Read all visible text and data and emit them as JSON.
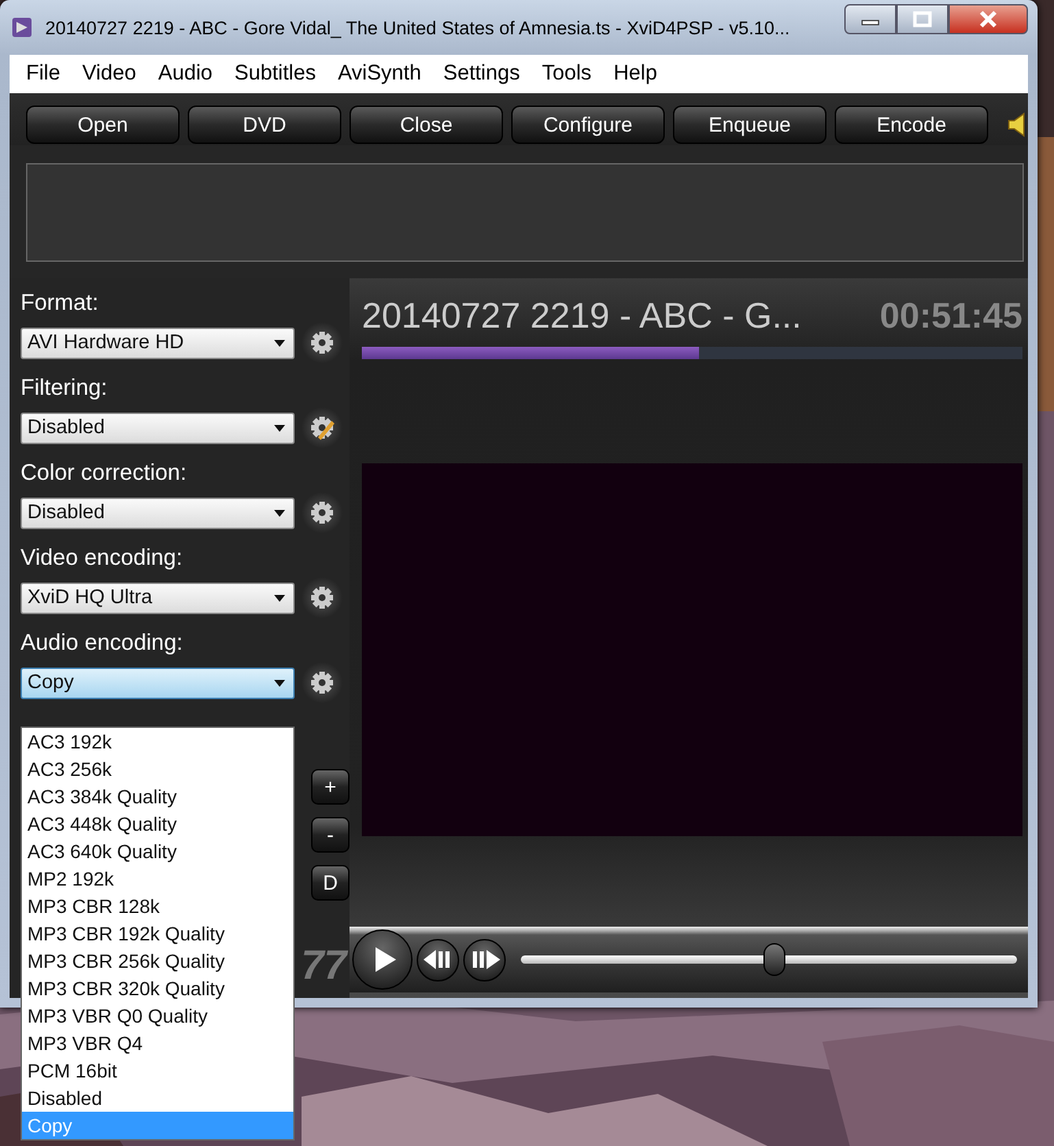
{
  "window": {
    "title": "20140727 2219 - ABC - Gore Vidal_ The United States of Amnesia.ts  - XviD4PSP - v5.10..."
  },
  "menu": [
    "File",
    "Video",
    "Audio",
    "Subtitles",
    "AviSynth",
    "Settings",
    "Tools",
    "Help"
  ],
  "toolbar": [
    "Open",
    "DVD",
    "Close",
    "Configure",
    "Enqueue",
    "Encode"
  ],
  "settings": [
    {
      "label": "Format:",
      "value": "AVI Hardware HD",
      "focused": false,
      "kind": "gear"
    },
    {
      "label": "Filtering:",
      "value": "Disabled",
      "focused": false,
      "kind": "edit"
    },
    {
      "label": "Color correction:",
      "value": "Disabled",
      "focused": false,
      "kind": "gear"
    },
    {
      "label": "Video encoding:",
      "value": "XviD HQ Ultra",
      "focused": false,
      "kind": "gear"
    },
    {
      "label": "Audio encoding:",
      "value": "Copy",
      "focused": true,
      "kind": "gear"
    }
  ],
  "side_buttons": [
    "+",
    "-",
    "D"
  ],
  "counter": "77",
  "player": {
    "file_title": "20140727 2219 - ABC - G...",
    "time": "00:51:45",
    "progress": {
      "level": 0.51
    },
    "seek": {
      "level": 0.51
    }
  },
  "dropdown": {
    "items": [
      {
        "label": "AC3 192k",
        "selected": false
      },
      {
        "label": "AC3 256k",
        "selected": false
      },
      {
        "label": "AC3 384k Quality",
        "selected": false
      },
      {
        "label": "AC3 448k Quality",
        "selected": false
      },
      {
        "label": "AC3 640k Quality",
        "selected": false
      },
      {
        "label": "MP2 192k",
        "selected": false
      },
      {
        "label": "MP3 CBR 128k",
        "selected": false
      },
      {
        "label": "MP3 CBR 192k Quality",
        "selected": false
      },
      {
        "label": "MP3 CBR 256k Quality",
        "selected": false
      },
      {
        "label": "MP3 CBR 320k Quality",
        "selected": false
      },
      {
        "label": "MP3 VBR Q0 Quality",
        "selected": false
      },
      {
        "label": "MP3 VBR Q4",
        "selected": false
      },
      {
        "label": "PCM 16bit",
        "selected": false
      },
      {
        "label": "Disabled",
        "selected": false
      },
      {
        "label": "Copy",
        "selected": true
      }
    ]
  }
}
